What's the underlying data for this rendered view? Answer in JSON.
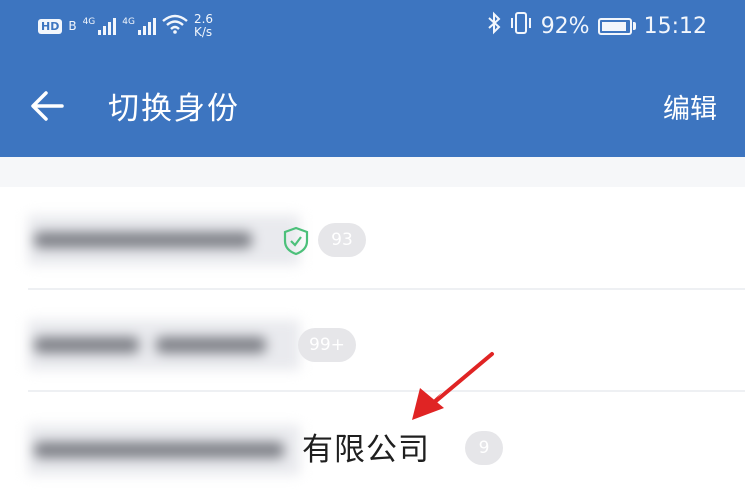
{
  "status_bar": {
    "hd_label": "HD",
    "hd_sub": "B",
    "sim1_label": "4G",
    "sim2_label": "4G",
    "net_speed_value": "2.6",
    "net_speed_unit": "K/s",
    "battery_text": "92%",
    "battery_level": 0.92,
    "time": "15:12",
    "icons": [
      "bluetooth-icon",
      "vibrate-icon",
      "wifi-icon",
      "signal-icon",
      "battery-icon"
    ]
  },
  "header": {
    "title": "切换身份",
    "edit_label": "编辑"
  },
  "identities": [
    {
      "badge": "93",
      "verified": true
    },
    {
      "badge": "99+",
      "verified": false
    },
    {
      "badge": "9",
      "name_suffix": "有限公司",
      "verified": false
    }
  ],
  "colors": {
    "header": "#3d75c0",
    "badge": "#e6e6e9",
    "verified": "#4cc07a",
    "annotation": "#e02424"
  }
}
